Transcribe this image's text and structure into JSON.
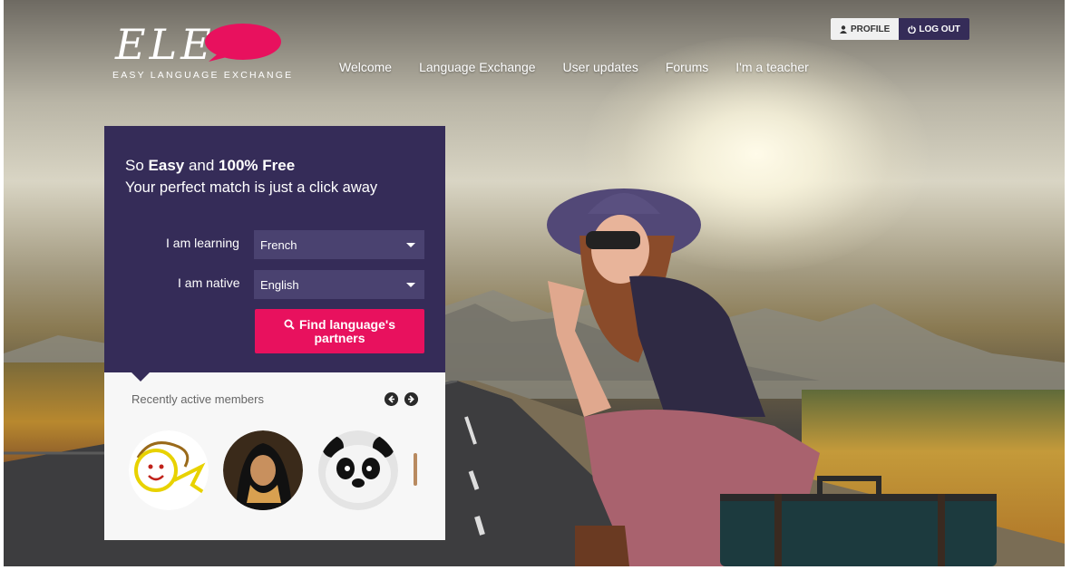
{
  "header": {
    "logo_text": "ELE",
    "tagline": "EASY LANGUAGE EXCHANGE",
    "nav": [
      "Welcome",
      "Language Exchange",
      "User updates",
      "Forums",
      "I'm a teacher"
    ],
    "profile_label": "PROFILE",
    "logout_label": "LOG OUT"
  },
  "hero": {
    "line1_a": "So ",
    "line1_b": "Easy",
    "line1_c": " and ",
    "line1_d": "100% Free",
    "line2": "Your perfect match is just a click away"
  },
  "search": {
    "learning_label": "I am learning",
    "learning_value": "French",
    "native_label": "I am native",
    "native_value": "English",
    "find_line1": "Find language's",
    "find_line2": "partners"
  },
  "members": {
    "title": "Recently active members"
  },
  "colors": {
    "brand_purple": "#352c58",
    "brand_pink": "#e8115e",
    "select_bg": "#4a4270"
  },
  "icons": [
    "user-icon",
    "power-icon",
    "search-icon",
    "chevron-left-icon",
    "chevron-right-icon",
    "caret-down-icon"
  ]
}
